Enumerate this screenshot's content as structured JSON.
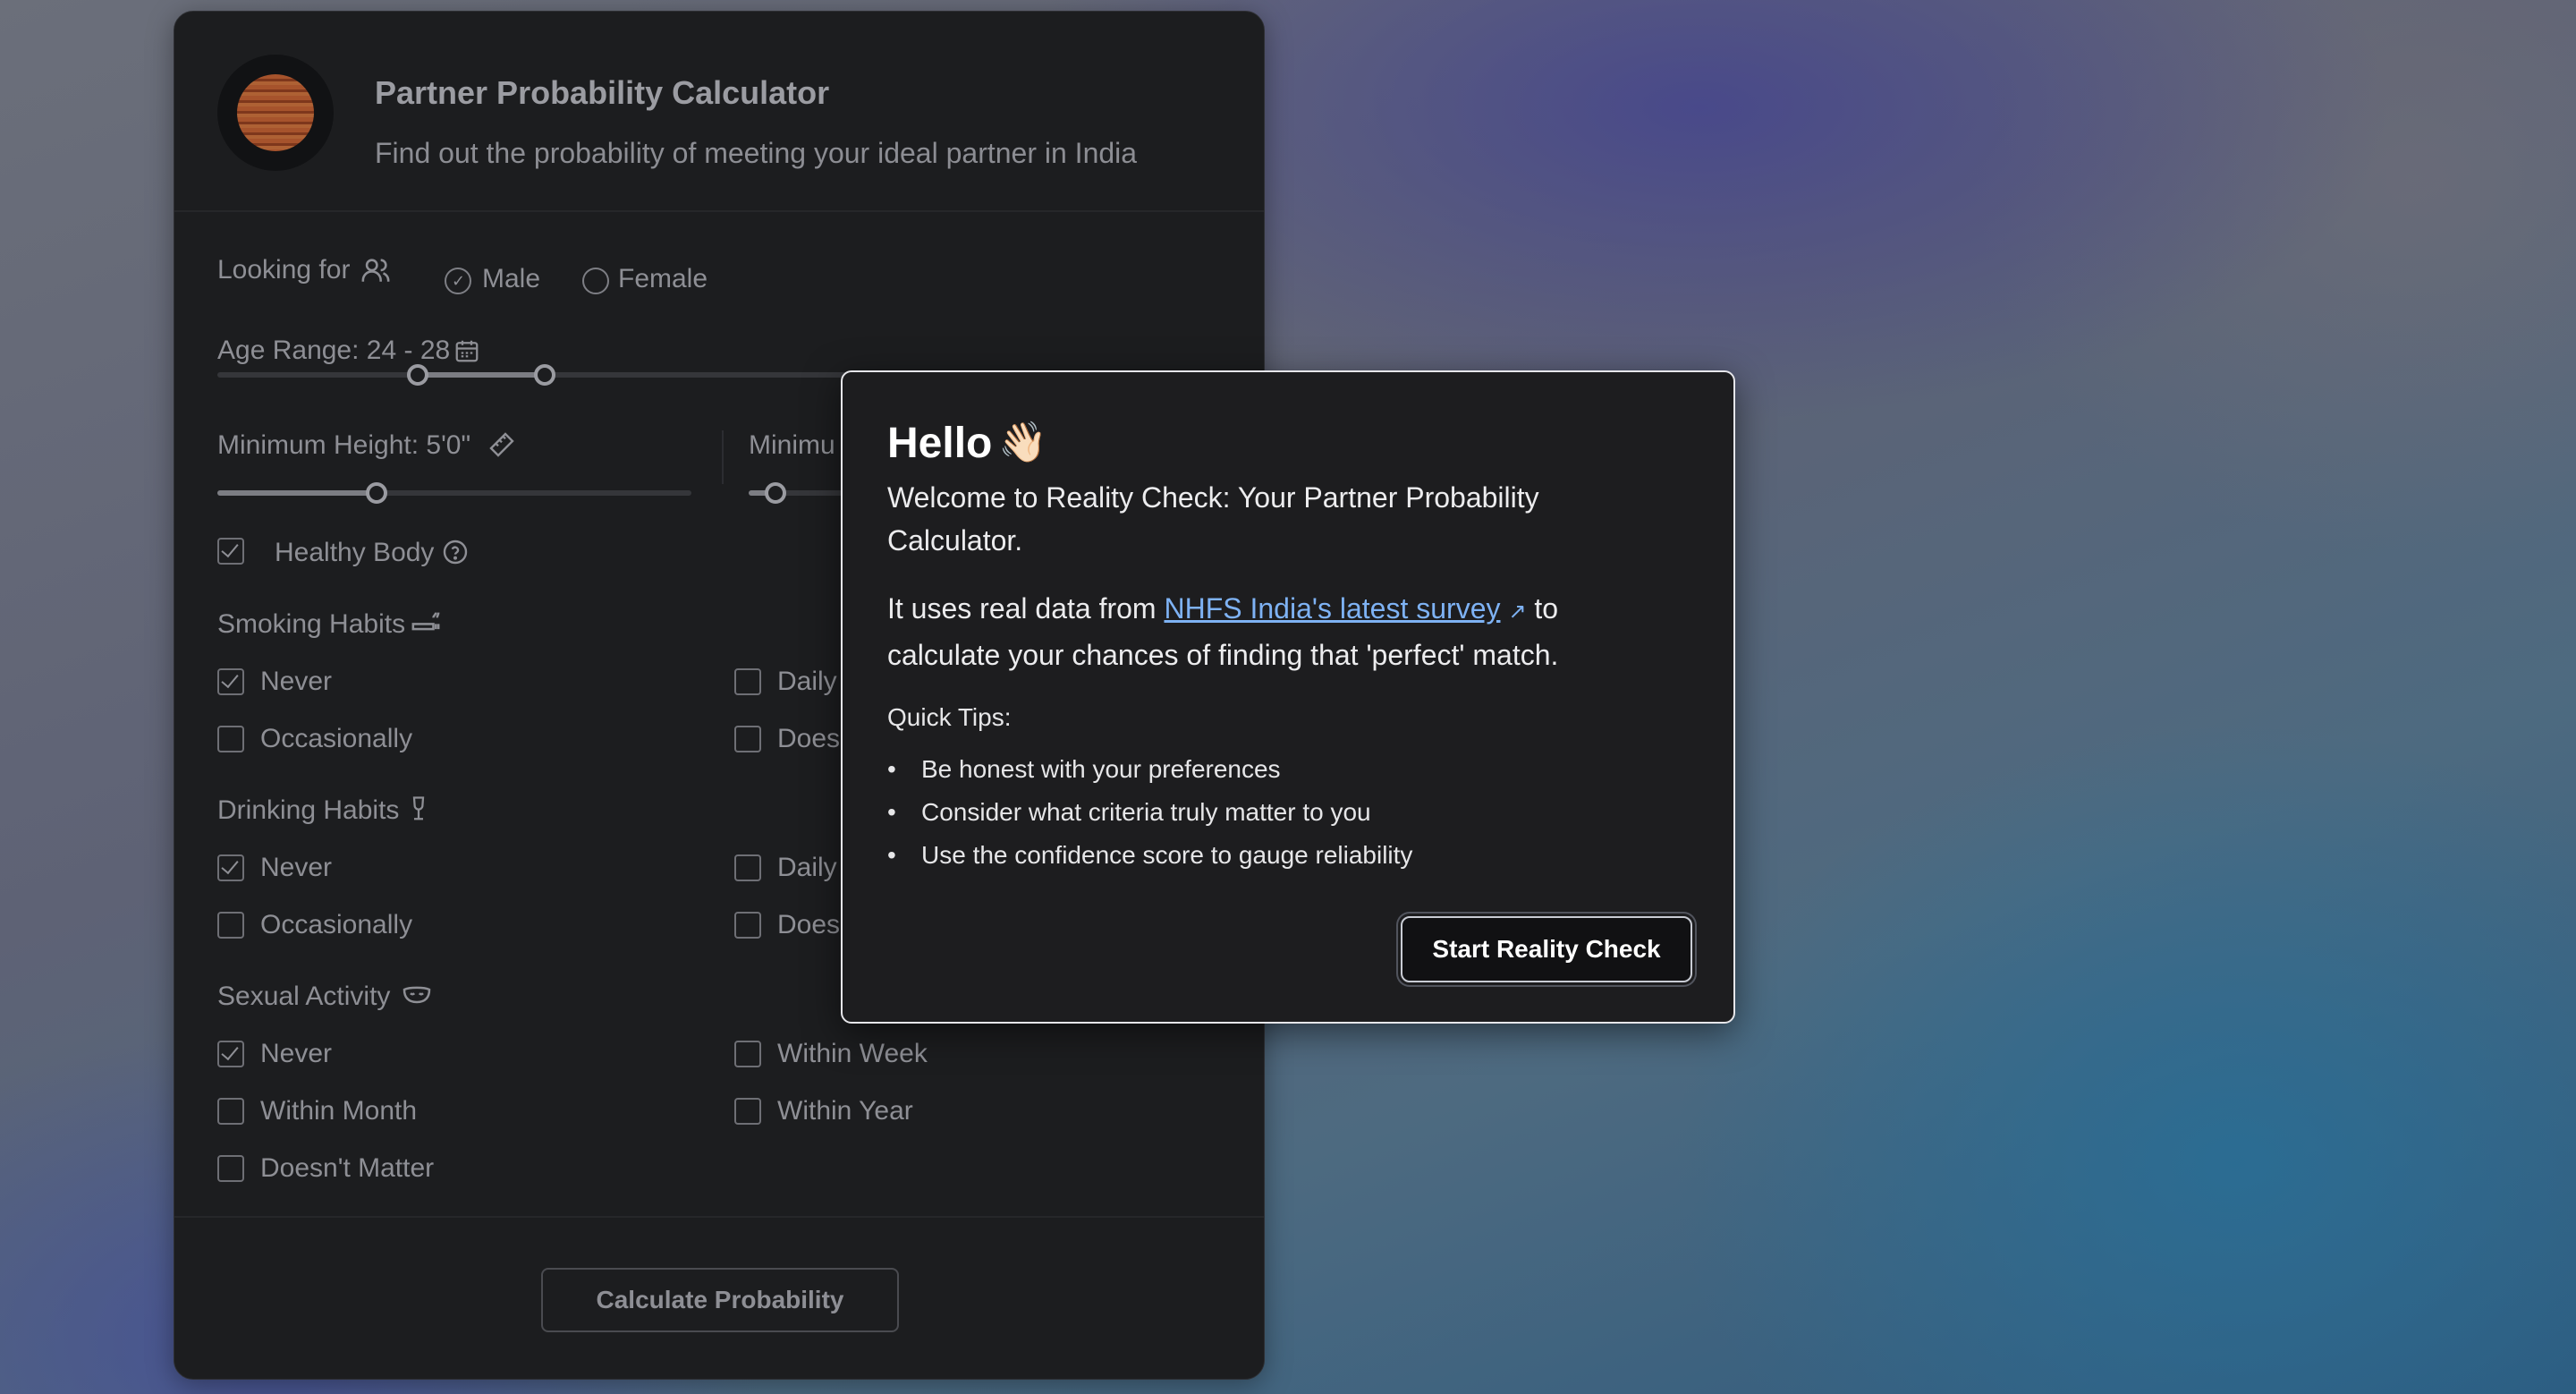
{
  "app": {
    "title": "Partner Probability Calculator",
    "subtitle": "Find out the probability of meeting your ideal partner in India"
  },
  "looking_for": {
    "label": "Looking for",
    "options": [
      "Male",
      "Female"
    ],
    "selected": "Male"
  },
  "age_range": {
    "label": "Age Range: 24 - 28",
    "min": 24,
    "max": 28
  },
  "min_height": {
    "label": "Minimum Height: 5'0\""
  },
  "min_other": {
    "label": "Minimu"
  },
  "healthy_body": {
    "label": "Healthy Body",
    "checked": true
  },
  "smoking": {
    "label": "Smoking Habits",
    "options": [
      {
        "label": "Never",
        "checked": true
      },
      {
        "label": "Daily",
        "checked": false
      },
      {
        "label": "Occasionally",
        "checked": false
      },
      {
        "label": "Does",
        "checked": false
      }
    ]
  },
  "drinking": {
    "label": "Drinking Habits",
    "options": [
      {
        "label": "Never",
        "checked": true
      },
      {
        "label": "Daily",
        "checked": false
      },
      {
        "label": "Occasionally",
        "checked": false
      },
      {
        "label": "Does",
        "checked": false
      }
    ]
  },
  "sexual": {
    "label": "Sexual Activity",
    "options": [
      {
        "label": "Never",
        "checked": true
      },
      {
        "label": "Within Week",
        "checked": false
      },
      {
        "label": "Within Month",
        "checked": false
      },
      {
        "label": "Within Year",
        "checked": false
      },
      {
        "label": "Doesn't Matter",
        "checked": false
      }
    ]
  },
  "calculate_label": "Calculate Probability",
  "modal": {
    "hello": "Hello",
    "wave": "👋🏻",
    "welcome": "Welcome to Reality Check: Your Partner Probability Calculator.",
    "p2_before": "It uses real data from ",
    "p2_link": "NHFS India's latest survey",
    "p2_after": " to calculate your chances of finding that 'perfect' match.",
    "tips_title": "Quick Tips:",
    "tips": [
      "Be honest with your preferences",
      "Consider what criteria truly matter to you",
      "Use the confidence score to gauge reliability"
    ],
    "start_label": "Start Reality Check"
  }
}
